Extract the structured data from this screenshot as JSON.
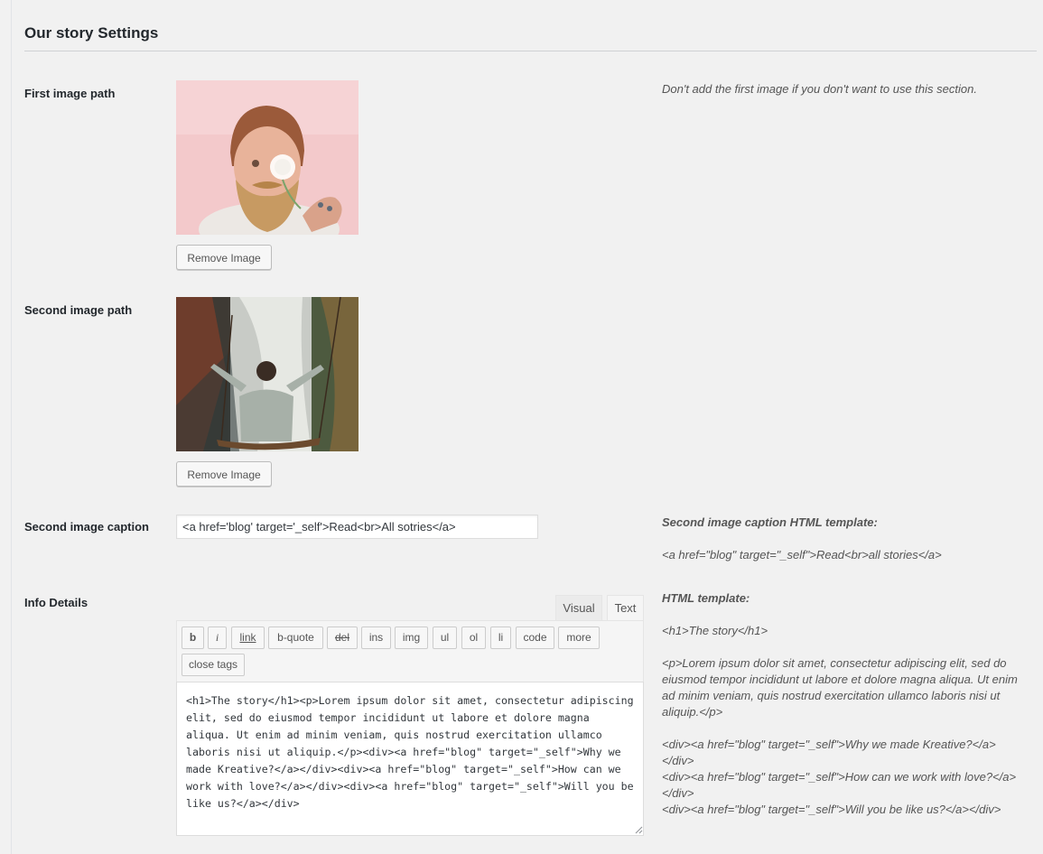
{
  "section": {
    "title": "Our story Settings"
  },
  "first_image": {
    "label": "First image path",
    "remove_label": "Remove Image",
    "hint": "Don't add the first image if you don't want to use this section."
  },
  "second_image": {
    "label": "Second image path",
    "remove_label": "Remove Image"
  },
  "caption": {
    "label": "Second image caption",
    "value": "<a href='blog' target='_self'>Read<br>All sotries</a>",
    "template_title": "Second image caption HTML template:",
    "template_example": "<a href=\"blog\" target=\"_self\">Read<br>all stories</a>"
  },
  "info": {
    "label": "Info Details",
    "tabs": {
      "visual": "Visual",
      "text": "Text"
    },
    "buttons": [
      "b",
      "i",
      "link",
      "b-quote",
      "del",
      "ins",
      "img",
      "ul",
      "ol",
      "li",
      "code",
      "more",
      "close tags"
    ],
    "content": "<h1>The story</h1><p>Lorem ipsum dolor sit amet, consectetur adipiscing elit, sed do eiusmod tempor incididunt ut labore et dolore magna aliqua. Ut enim ad minim veniam, quis nostrud exercitation ullamco laboris nisi ut aliquip.</p><div><a href=\"blog\" target=\"_self\">Why we made Kreative?</a></div><div><a href=\"blog\" target=\"_self\">How can we work with love?</a></div><div><a href=\"blog\" target=\"_self\">Will you be like us?</a></div>",
    "template_title": "HTML template:",
    "template_lines": [
      "<h1>The story</h1>",
      "<p>Lorem ipsum dolor sit amet, consectetur adipiscing elit, sed do eiusmod tempor incididunt ut labore et dolore magna aliqua. Ut enim ad minim veniam, quis nostrud exercitation ullamco laboris nisi ut aliquip.</p>",
      "<div><a href=\"blog\" target=\"_self\">Why we made Kreative?</a></div>",
      "<div><a href=\"blog\" target=\"_self\">How can we work with love?</a></div>",
      "<div><a href=\"blog\" target=\"_self\">Will you be like us?</a></div>"
    ]
  },
  "colors": {
    "page_bg": "#f1f1f1",
    "button_border": "#bcbcbc",
    "accent_text": "#23282d"
  }
}
